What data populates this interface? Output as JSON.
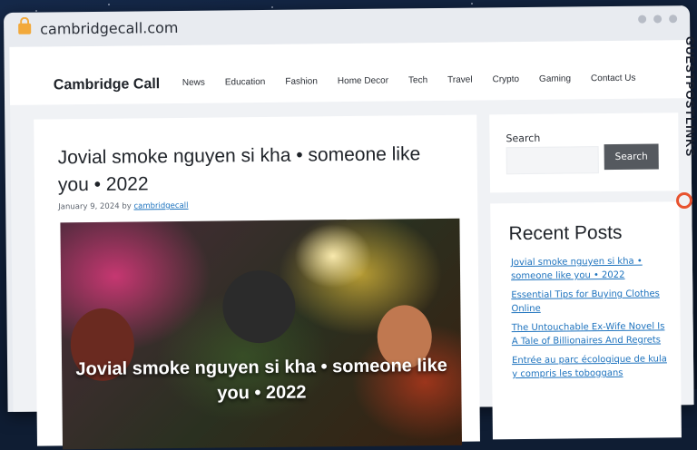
{
  "browser": {
    "url": "cambridgecall.com"
  },
  "site": {
    "brand": "Cambridge Call",
    "nav": [
      "News",
      "Education",
      "Fashion",
      "Home Decor",
      "Tech",
      "Travel",
      "Crypto",
      "Gaming",
      "Contact Us"
    ]
  },
  "post": {
    "title": "Jovial smoke nguyen si kha • someone like you • 2022",
    "date": "January 9, 2024",
    "by": "by",
    "author": "cambridgecall",
    "hero_caption": "Jovial smoke nguyen si kha • someone like you • 2022"
  },
  "sidebar": {
    "search_label": "Search",
    "search_button": "Search",
    "recent_title": "Recent Posts",
    "recent_posts": [
      "Jovial smoke nguyen si kha • someone like you • 2022",
      "Essential Tips for Buying Clothes Online",
      "The Untouchable Ex-Wife Novel Is A Tale of Billionaires And Regrets",
      "Entrée au parc écologique de kula y compris les toboggans"
    ]
  },
  "watermark": {
    "text": "GUESTPOSTLINKS"
  },
  "colors": {
    "link": "#1e73be",
    "button": "#55595f",
    "lock": "#f2a93b",
    "watermark_icon": "#e8532f"
  }
}
